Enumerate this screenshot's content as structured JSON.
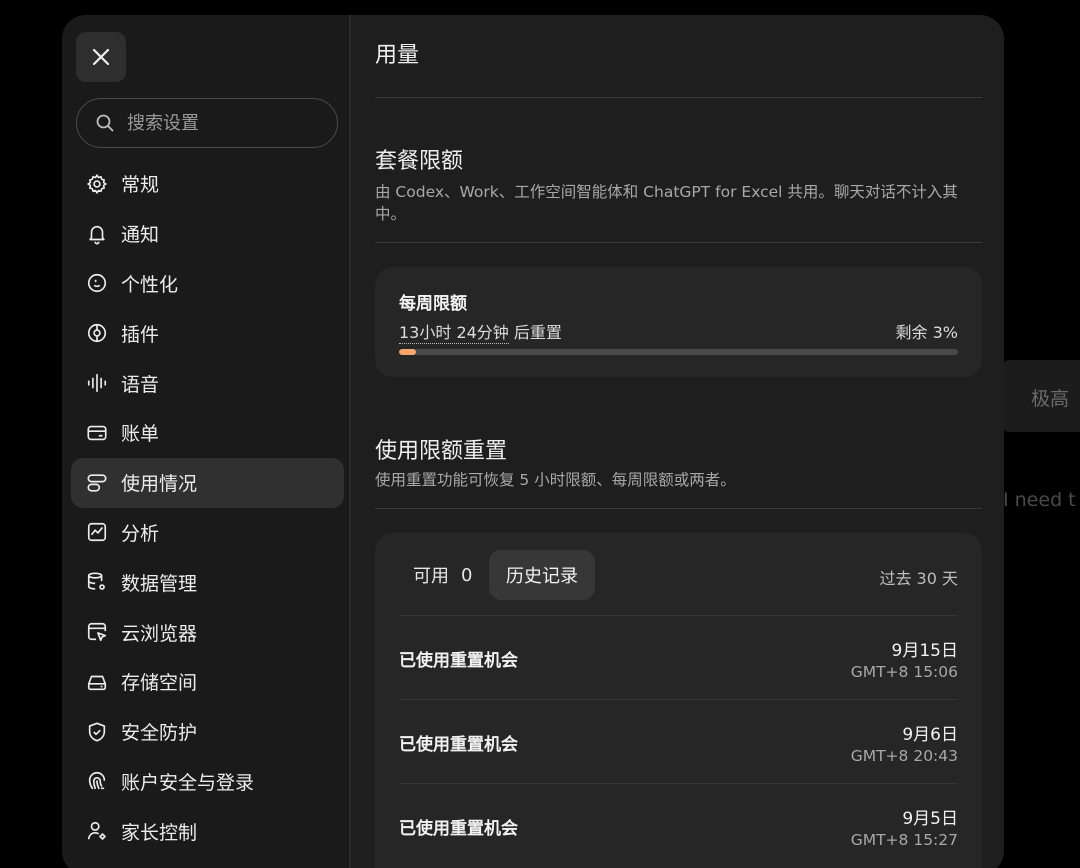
{
  "background": {
    "pill_text": "极高",
    "trailing_text": "I need t"
  },
  "sidebar": {
    "search_placeholder": "搜索设置",
    "items": [
      {
        "label": "常规",
        "icon": "gear-icon"
      },
      {
        "label": "通知",
        "icon": "bell-icon"
      },
      {
        "label": "个性化",
        "icon": "smiley-icon"
      },
      {
        "label": "插件",
        "icon": "plugin-icon"
      },
      {
        "label": "语音",
        "icon": "waveform-icon"
      },
      {
        "label": "账单",
        "icon": "card-icon"
      },
      {
        "label": "使用情况",
        "icon": "usage-icon",
        "active": true
      },
      {
        "label": "分析",
        "icon": "analytics-icon"
      },
      {
        "label": "数据管理",
        "icon": "database-icon"
      },
      {
        "label": "云浏览器",
        "icon": "cloud-browser-icon"
      },
      {
        "label": "存储空间",
        "icon": "storage-icon"
      },
      {
        "label": "安全防护",
        "icon": "shield-icon"
      },
      {
        "label": "账户安全与登录",
        "icon": "account-security-icon"
      },
      {
        "label": "家长控制",
        "icon": "parental-control-icon"
      }
    ]
  },
  "main": {
    "title": "用量",
    "plan_limits": {
      "title": "套餐限额",
      "description": "由 Codex、Work、工作空间智能体和 ChatGPT for Excel 共用。聊天对话不计入其中。"
    },
    "weekly": {
      "title": "每周限额",
      "reset_time": "13小时 24分钟",
      "reset_suffix": " 后重置",
      "remaining": "剩余 3%",
      "remaining_fraction": 0.03,
      "bar_color": "#f5a56b"
    },
    "reset_section": {
      "title": "使用限额重置",
      "description": "使用重置功能可恢复 5 小时限额、每周限额或两者。"
    },
    "history": {
      "tab_available": "可用",
      "available_count": "0",
      "tab_history": "历史记录",
      "period": "过去 30 天",
      "rows": [
        {
          "label": "已使用重置机会",
          "date": "9月15日",
          "time": "GMT+8 15:06"
        },
        {
          "label": "已使用重置机会",
          "date": "9月6日",
          "time": "GMT+8 20:43"
        },
        {
          "label": "已使用重置机会",
          "date": "9月5日",
          "time": "GMT+8 15:27"
        }
      ]
    }
  }
}
